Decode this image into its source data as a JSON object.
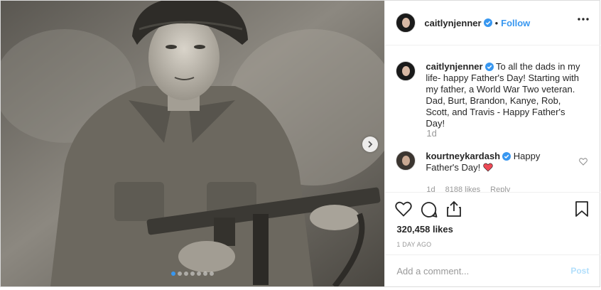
{
  "header": {
    "username": "caitlynjenner",
    "separator": "•",
    "follow_label": "Follow",
    "more_icon": "more-horizontal-icon"
  },
  "caption": {
    "username": "caitlynjenner",
    "text": "To all the dads in my life- happy Father's Day! Starting with my father, a World War Two veteran. Dad, Burt, Brandon, Kanye, Rob, Scott, and Travis - Happy Father's Day!",
    "time": "1d"
  },
  "comments": [
    {
      "username": "kourtneykardash",
      "text": "Happy Father's Day!",
      "emoji_icon": "red-heart-icon",
      "time": "1d",
      "likes": "8188 likes",
      "reply_label": "Reply"
    }
  ],
  "actions": {
    "like_icon": "heart-outline-icon",
    "comment_icon": "comment-bubble-icon",
    "share_icon": "share-upload-icon",
    "save_icon": "bookmark-icon"
  },
  "likes_text": "320,458 likes",
  "date_text": "1 DAY AGO",
  "add_comment": {
    "placeholder": "Add a comment...",
    "post_label": "Post"
  },
  "carousel": {
    "total": 7,
    "active_index": 0
  },
  "colors": {
    "accent": "#3897f0",
    "verified": "#3897f0",
    "heart": "#ed4956",
    "post_disabled": "#b2dffc",
    "muted": "#999999"
  }
}
